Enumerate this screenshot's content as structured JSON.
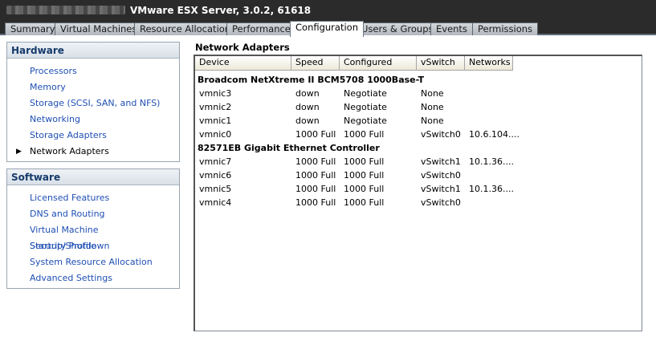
{
  "header": {
    "server_title": "VMware ESX Server, 3.0.2, 61618"
  },
  "tabs": [
    {
      "label": "Summary"
    },
    {
      "label": "Virtual Machines"
    },
    {
      "label": "Resource Allocation"
    },
    {
      "label": "Performance"
    },
    {
      "label": "Configuration",
      "active": true
    },
    {
      "label": "Users & Groups"
    },
    {
      "label": "Events"
    },
    {
      "label": "Permissions"
    }
  ],
  "hardware": {
    "title": "Hardware",
    "items": [
      {
        "label": "Processors"
      },
      {
        "label": "Memory"
      },
      {
        "label": "Storage (SCSI, SAN, and NFS)"
      },
      {
        "label": "Networking"
      },
      {
        "label": "Storage Adapters"
      },
      {
        "label": "Network Adapters",
        "selected": true
      }
    ]
  },
  "software": {
    "title": "Software",
    "items": [
      {
        "label": "Licensed Features"
      },
      {
        "label": "DNS and Routing"
      },
      {
        "label": "Virtual Machine Startup/Shutdown"
      },
      {
        "label": "Security Profile"
      },
      {
        "label": "System Resource Allocation"
      },
      {
        "label": "Advanced Settings"
      }
    ]
  },
  "main": {
    "title": "Network Adapters",
    "columns": [
      "Device",
      "Speed",
      "Configured",
      "vSwitch",
      "Networks"
    ],
    "groups": [
      {
        "name": "Broadcom NetXtreme II BCM5708 1000Base-T",
        "rows": [
          [
            "vmnic3",
            "down",
            "Negotiate",
            "None",
            ""
          ],
          [
            "vmnic2",
            "down",
            "Negotiate",
            "None",
            ""
          ],
          [
            "vmnic1",
            "down",
            "Negotiate",
            "None",
            ""
          ],
          [
            "vmnic0",
            "1000 Full",
            "1000 Full",
            "vSwitch0",
            "10.6.104...."
          ]
        ]
      },
      {
        "name": "82571EB Gigabit Ethernet Controller",
        "rows": [
          [
            "vmnic7",
            "1000 Full",
            "1000 Full",
            "vSwitch1",
            "10.1.36...."
          ],
          [
            "vmnic6",
            "1000 Full",
            "1000 Full",
            "vSwitch0",
            ""
          ],
          [
            "vmnic5",
            "1000 Full",
            "1000 Full",
            "vSwitch1",
            "10.1.36...."
          ],
          [
            "vmnic4",
            "1000 Full",
            "1000 Full",
            "vSwitch0",
            ""
          ]
        ]
      }
    ]
  }
}
